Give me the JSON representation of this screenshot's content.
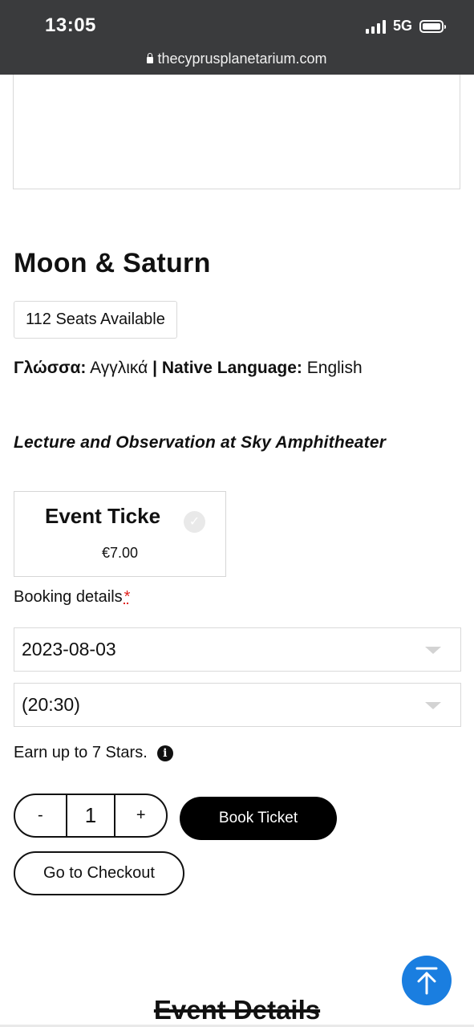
{
  "status_bar": {
    "time": "13:05",
    "network": "5G",
    "url": "thecyprusplanetarium.com"
  },
  "event": {
    "title": "Moon & Saturn",
    "seats": "112 Seats Available",
    "language_label_gr": "Γλώσσα:",
    "language_value_gr": "Αγγλικά",
    "language_sep": "|",
    "language_label_en": "Native Language:",
    "language_value_en": "English",
    "subtitle": "Lecture and Observation at Sky Amphitheater"
  },
  "ticket": {
    "name": "Event Ticke",
    "price": "€7.00"
  },
  "booking": {
    "label": "Booking details",
    "required_mark": "*",
    "date": "2023-08-03",
    "time": "(20:30)"
  },
  "stars": {
    "text": "Earn up to 7 Stars."
  },
  "quantity": {
    "minus": "-",
    "value": "1",
    "plus": "+"
  },
  "actions": {
    "book": "Book Ticket",
    "checkout": "Go to Checkout"
  },
  "section": {
    "heading": "Event Details"
  },
  "colors": {
    "status_bar_bg": "#3a3b3d",
    "scroll_button": "#1a7ee0",
    "required": "#e0201b"
  },
  "icons": [
    "lock-icon",
    "check-icon",
    "info-icon",
    "chevron-down-icon",
    "arrow-up-icon"
  ]
}
